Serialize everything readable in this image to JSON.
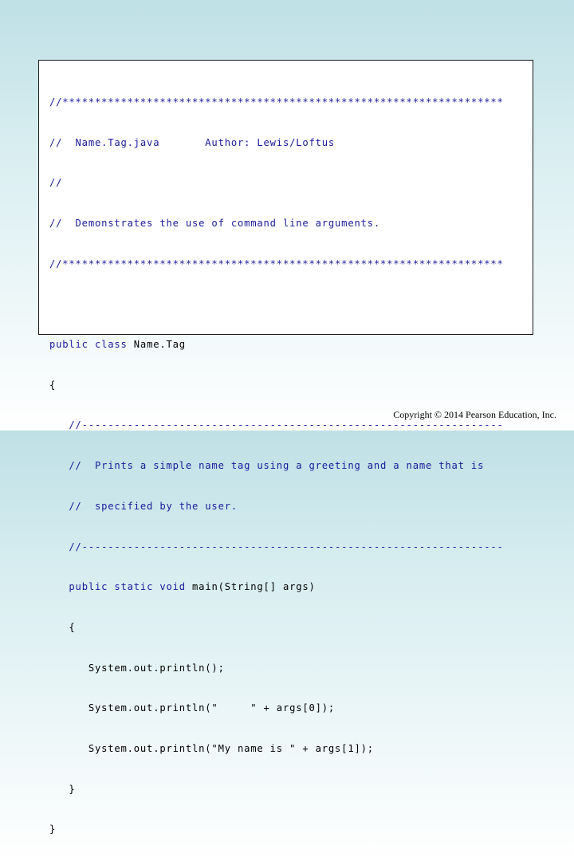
{
  "code": {
    "header_rule_top": "//********************************************************************",
    "header_file_line": "//  Name.Tag.java       Author: Lewis/Loftus",
    "header_blank_comment": "//",
    "header_desc_line": "//  Demonstrates the use of command line arguments.",
    "header_rule_bottom": "//********************************************************************",
    "class_decl_keywords": "public class ",
    "class_name": "Name.Tag",
    "class_open_brace": "{",
    "method_rule_top": "   //-----------------------------------------------------------------",
    "method_comment_1": "   //  Prints a simple name tag using a greeting and a name that is",
    "method_comment_2": "   //  specified by the user.",
    "method_rule_bottom": "   //-----------------------------------------------------------------",
    "method_sig_indent": "   ",
    "method_sig_keywords": "public static void ",
    "method_sig_rest": "main(String[] args)",
    "method_open_brace": "   {",
    "stmt_1": "      System.out.println();",
    "stmt_2": "      System.out.println(\"     \" + args[0]);",
    "stmt_3": "      System.out.println(\"My name is \" + args[1]);",
    "method_close_brace": "   }",
    "class_close_brace": "}"
  },
  "footer": {
    "copyright": "Copyright © 2014 Pearson Education, Inc."
  },
  "colors": {
    "keyword": "#1a1a9c",
    "comment": "#1a1a9c",
    "text": "#000000",
    "frame_border": "#1a1a1a"
  }
}
